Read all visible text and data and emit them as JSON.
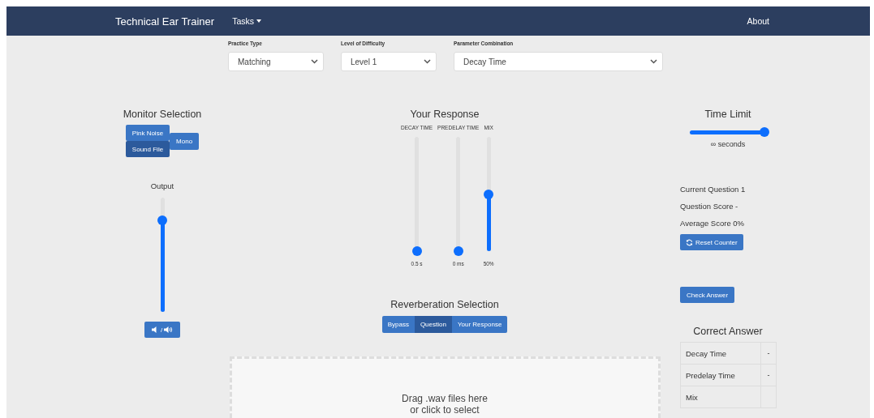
{
  "navbar": {
    "brand": "Technical Ear Trainer",
    "menu": "Tasks",
    "link": "About"
  },
  "settings": [
    {
      "label": "Practice Type",
      "value": "Matching"
    },
    {
      "label": "Level of Difficulty",
      "value": "Level 1"
    },
    {
      "label": "Parameter Combination",
      "value": "Decay Time"
    }
  ],
  "monitor": {
    "title": "Monitor Selection",
    "sources": [
      {
        "label": "Pink Noise",
        "selected": false
      },
      {
        "label": "Sound File",
        "selected": true
      }
    ],
    "mono": {
      "label": "Mono",
      "selected": false
    }
  },
  "output": {
    "label": "Output",
    "level": 0.8,
    "mute_separator": "/"
  },
  "response": {
    "title": "Your Response",
    "sliders": [
      {
        "label": "DECAY TIME",
        "level": 0,
        "reading": "0.5 s"
      },
      {
        "label": "PREDELAY TIME",
        "level": 0,
        "reading": "0 ms"
      },
      {
        "label": "MIX",
        "level": 0.5,
        "reading": "50%"
      }
    ]
  },
  "reverb": {
    "title": "Reverberation Selection",
    "options": [
      {
        "label": "Bypass",
        "selected": false
      },
      {
        "label": "Question",
        "selected": true
      },
      {
        "label": "Your Response",
        "selected": false
      }
    ]
  },
  "dropzone": {
    "lines": [
      "Drag .wav files here",
      "or click to select"
    ]
  },
  "time_limit": {
    "title": "Time Limit",
    "level": 1,
    "reading": "∞ seconds"
  },
  "stats": [
    "Current Question 1",
    "Question Score -",
    "Average Score 0%"
  ],
  "reset_button": "Reset Counter",
  "check_button": "Check Answer",
  "correct_answer": {
    "title": "Correct Answer",
    "rows": [
      {
        "parameter": "Decay Time",
        "value": "-"
      },
      {
        "parameter": "Predelay Time",
        "value": "-"
      },
      {
        "parameter": "Mix"
      }
    ]
  }
}
